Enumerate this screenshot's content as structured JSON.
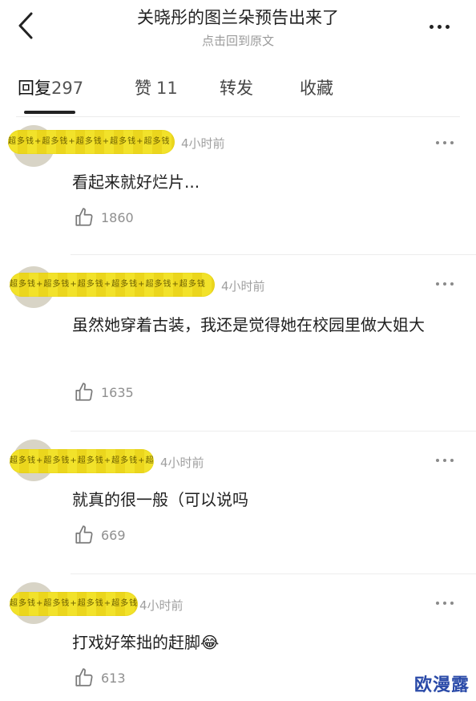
{
  "header": {
    "title": "关晓彤的图兰朵预告出来了",
    "subtitle": "点击回到原文"
  },
  "tabs": [
    {
      "label": "回复",
      "count": "297"
    },
    {
      "label": "赞",
      "count": "11"
    },
    {
      "label": "转发",
      "count": ""
    },
    {
      "label": "收藏",
      "count": ""
    }
  ],
  "comments": [
    {
      "mask_text": "超多钱+超多钱+超多钱+超多钱+超多钱",
      "time": "4小时前",
      "text": "看起来就好烂片...",
      "likes": "1860"
    },
    {
      "mask_text": "超多钱+超多钱+超多钱+超多钱+超多钱+超多钱",
      "time": "4小时前",
      "text": "虽然她穿着古装，我还是觉得她在校园里做大姐大",
      "likes": "1635"
    },
    {
      "mask_text": "超多钱+超多钱+超多钱+超多钱+超多钱",
      "time": "4小时前",
      "text": "就真的很一般（可以说吗",
      "likes": "669"
    },
    {
      "mask_text": "超多钱+超多钱+超多钱+超多钱",
      "time": "4小时前",
      "text": "打戏好笨拙的赶脚",
      "emoji": "😂",
      "likes": "613"
    }
  ],
  "watermark": "欧漫露",
  "icons": {
    "back": "chevron-left-icon",
    "more": "more-dots-icon",
    "like": "thumbs-up-icon"
  }
}
